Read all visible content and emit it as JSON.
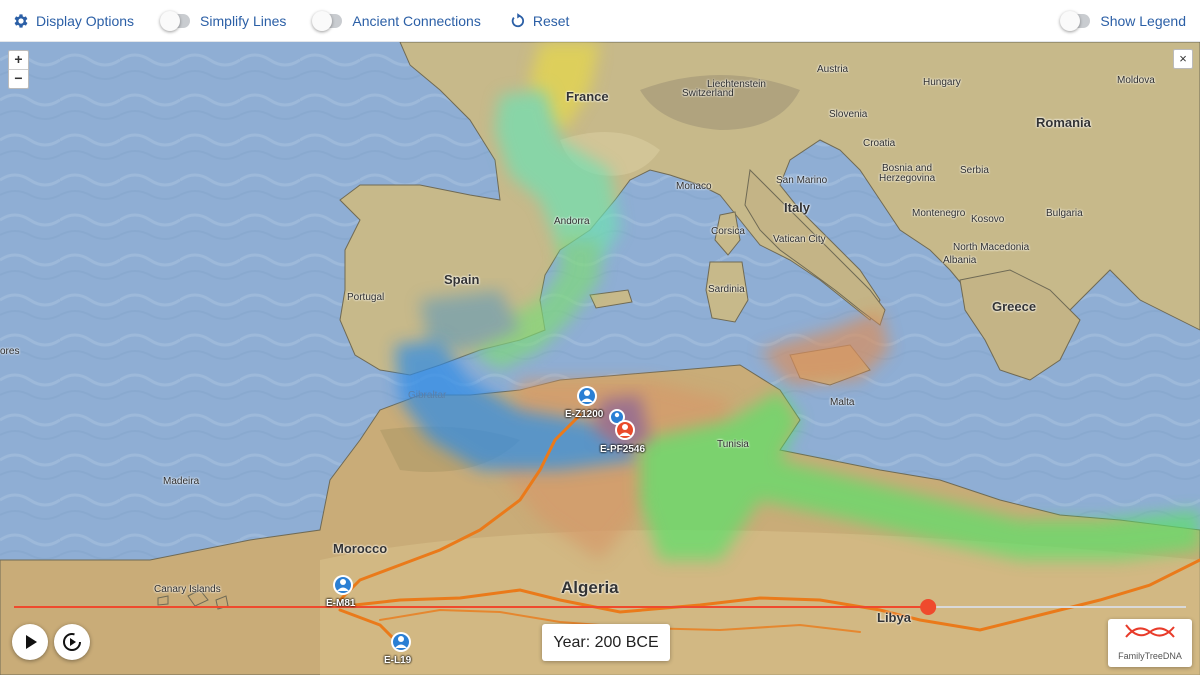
{
  "toolbar": {
    "display_options": "Display Options",
    "simplify_lines": "Simplify Lines",
    "ancient_connections": "Ancient Connections",
    "reset": "Reset",
    "show_legend": "Show Legend"
  },
  "zoom": {
    "in": "+",
    "out": "−"
  },
  "close": "×",
  "map_labels": {
    "france": "France",
    "austria": "Austria",
    "hungary": "Hungary",
    "moldova": "Moldova",
    "liechtenstein": "Liechtenstein",
    "switzerland": "Switzerland",
    "slovenia": "Slovenia",
    "croatia": "Croatia",
    "romania": "Romania",
    "bosnia1": "Bosnia and",
    "bosnia2": "Herzegovina",
    "serbia": "Serbia",
    "monaco": "Monaco",
    "san_marino": "San Marino",
    "italy": "Italy",
    "montenegro": "Montenegro",
    "kosovo": "Kosovo",
    "bulgaria": "Bulgaria",
    "andorra": "Andorra",
    "corsica": "Corsica",
    "vatican": "Vatican City",
    "north_macedonia": "North Macedonia",
    "albania": "Albania",
    "spain": "Spain",
    "portugal": "Portugal",
    "sardinia": "Sardinia",
    "greece": "Greece",
    "ores": "ores",
    "gibraltar": "Gibraltar",
    "malta": "Malta",
    "tunisia": "Tunisia",
    "madeira": "Madeira",
    "morocco": "Morocco",
    "canary": "Canary Islands",
    "algeria": "Algeria",
    "libya": "Libya"
  },
  "markers": {
    "ez1200": "E-Z1200",
    "epf2546": "E-PF2546",
    "em81": "E-M81",
    "el19": "E-L19"
  },
  "timeline": {
    "progress": 0.78
  },
  "year": "Year: 200 BCE",
  "logo": "FamilyTreeDNA"
}
